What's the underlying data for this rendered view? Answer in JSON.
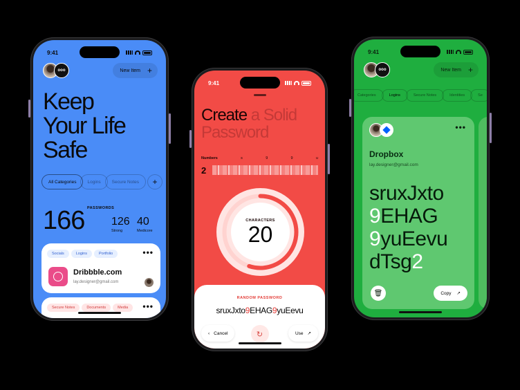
{
  "status": {
    "time": "9:41"
  },
  "vault": {
    "new_item_label": "New Item",
    "avatar_badge": "ooo",
    "headline": [
      "Keep",
      "Your Life",
      "Safe"
    ],
    "categories": [
      "All Categories",
      "Logins",
      "Secure Notes"
    ],
    "passwords_count": "166",
    "passwords_label": "PASSWORDS",
    "strong_count": "126",
    "strong_label": "Strong",
    "medicore_count": "40",
    "medicore_label": "Medicore",
    "card1": {
      "tags": [
        "Socials",
        "Logins",
        "Portfolio"
      ],
      "title": "Dribbble.com",
      "email": "lay.designer@gmail.com"
    },
    "card2": {
      "tags": [
        "Secure Notes",
        "Documents",
        "Media"
      ]
    }
  },
  "generator": {
    "headline_a": "Create",
    "headline_b": " a Solid",
    "headline_c": "Password",
    "numbers_label": "Numbers",
    "tick_labels": [
      "s",
      "9",
      "9",
      "u"
    ],
    "numbers_value": "2",
    "numbers_fraction": 0.1,
    "characters_label": "CHARACTERS",
    "characters_value": "20",
    "characters_fraction": 0.55,
    "random_label": "RANDOM PASSWORD",
    "password_parts": [
      "sruxJxto",
      "9",
      "EHAG",
      "9",
      "yuEevu"
    ],
    "cancel_label": "Cancel",
    "use_label": "Use"
  },
  "detail": {
    "new_item_label": "New Item",
    "avatar_badge": "ooo",
    "tabs": [
      "Categories",
      "Logins",
      "Secure Notes",
      "Identities",
      "Se"
    ],
    "title": "Dropbox",
    "email": "lay.designer@gmail.com",
    "pass_lines": [
      [
        "sruxJxto",
        ""
      ],
      [
        "9",
        "EHAG"
      ],
      [
        "9",
        "yuEevu"
      ],
      [
        "dTsg",
        "2"
      ]
    ],
    "copy_label": "Copy"
  },
  "colors": {
    "blue": "#4a8cf7",
    "red": "#f24b46",
    "green": "#1fae3f"
  }
}
